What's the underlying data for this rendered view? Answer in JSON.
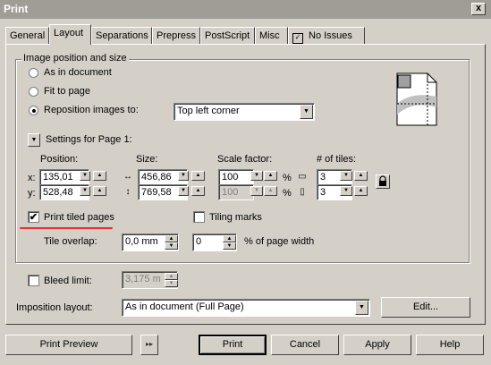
{
  "window": {
    "title": "Print",
    "close_glyph": "x"
  },
  "tabs": [
    "General",
    "Layout",
    "Separations",
    "Prepress",
    "PostScript",
    "Misc",
    "No Issues"
  ],
  "image_position": {
    "group_label": "Image position and size",
    "as_in_document": "As in document",
    "fit_to_page": "Fit to page",
    "reposition": "Reposition images to:",
    "reposition_value": "Top left corner"
  },
  "settings_for_page": "Settings for Page 1:",
  "headers": {
    "position": "Position:",
    "size": "Size:",
    "scale": "Scale factor:",
    "tiles": "# of tiles:"
  },
  "position": {
    "x_label": "x:",
    "x_value": "135,01",
    "y_label": "y:",
    "y_value": "528,48"
  },
  "size": {
    "w_value": "456,86",
    "h_value": "769,58"
  },
  "scale": {
    "x_value": "100",
    "y_value": "100",
    "unit": "%"
  },
  "tiles": {
    "x_value": "3",
    "y_value": "3"
  },
  "print_tiled_pages": "Print tiled pages",
  "tiling_marks": "Tiling marks",
  "tile_overlap": {
    "label": "Tile overlap:",
    "value": "0,0 mm",
    "width_value": "0",
    "width_label": "% of page width"
  },
  "bleed": {
    "label": "Bleed limit:",
    "value": "3,175 m"
  },
  "imposition": {
    "label": "Imposition layout:",
    "value": "As in document (Full Page)",
    "edit": "Edit..."
  },
  "buttons": {
    "preview": "Print Preview",
    "print": "Print",
    "cancel": "Cancel",
    "apply": "Apply",
    "help": "Help"
  },
  "glyphs": {
    "check": "✔",
    "up": "▲",
    "down": "▼",
    "dd": "▼",
    "chev": "▸▸"
  },
  "colors": {
    "face": "#d4d0c8",
    "title": "#a09d97",
    "underline": "#e03030"
  }
}
